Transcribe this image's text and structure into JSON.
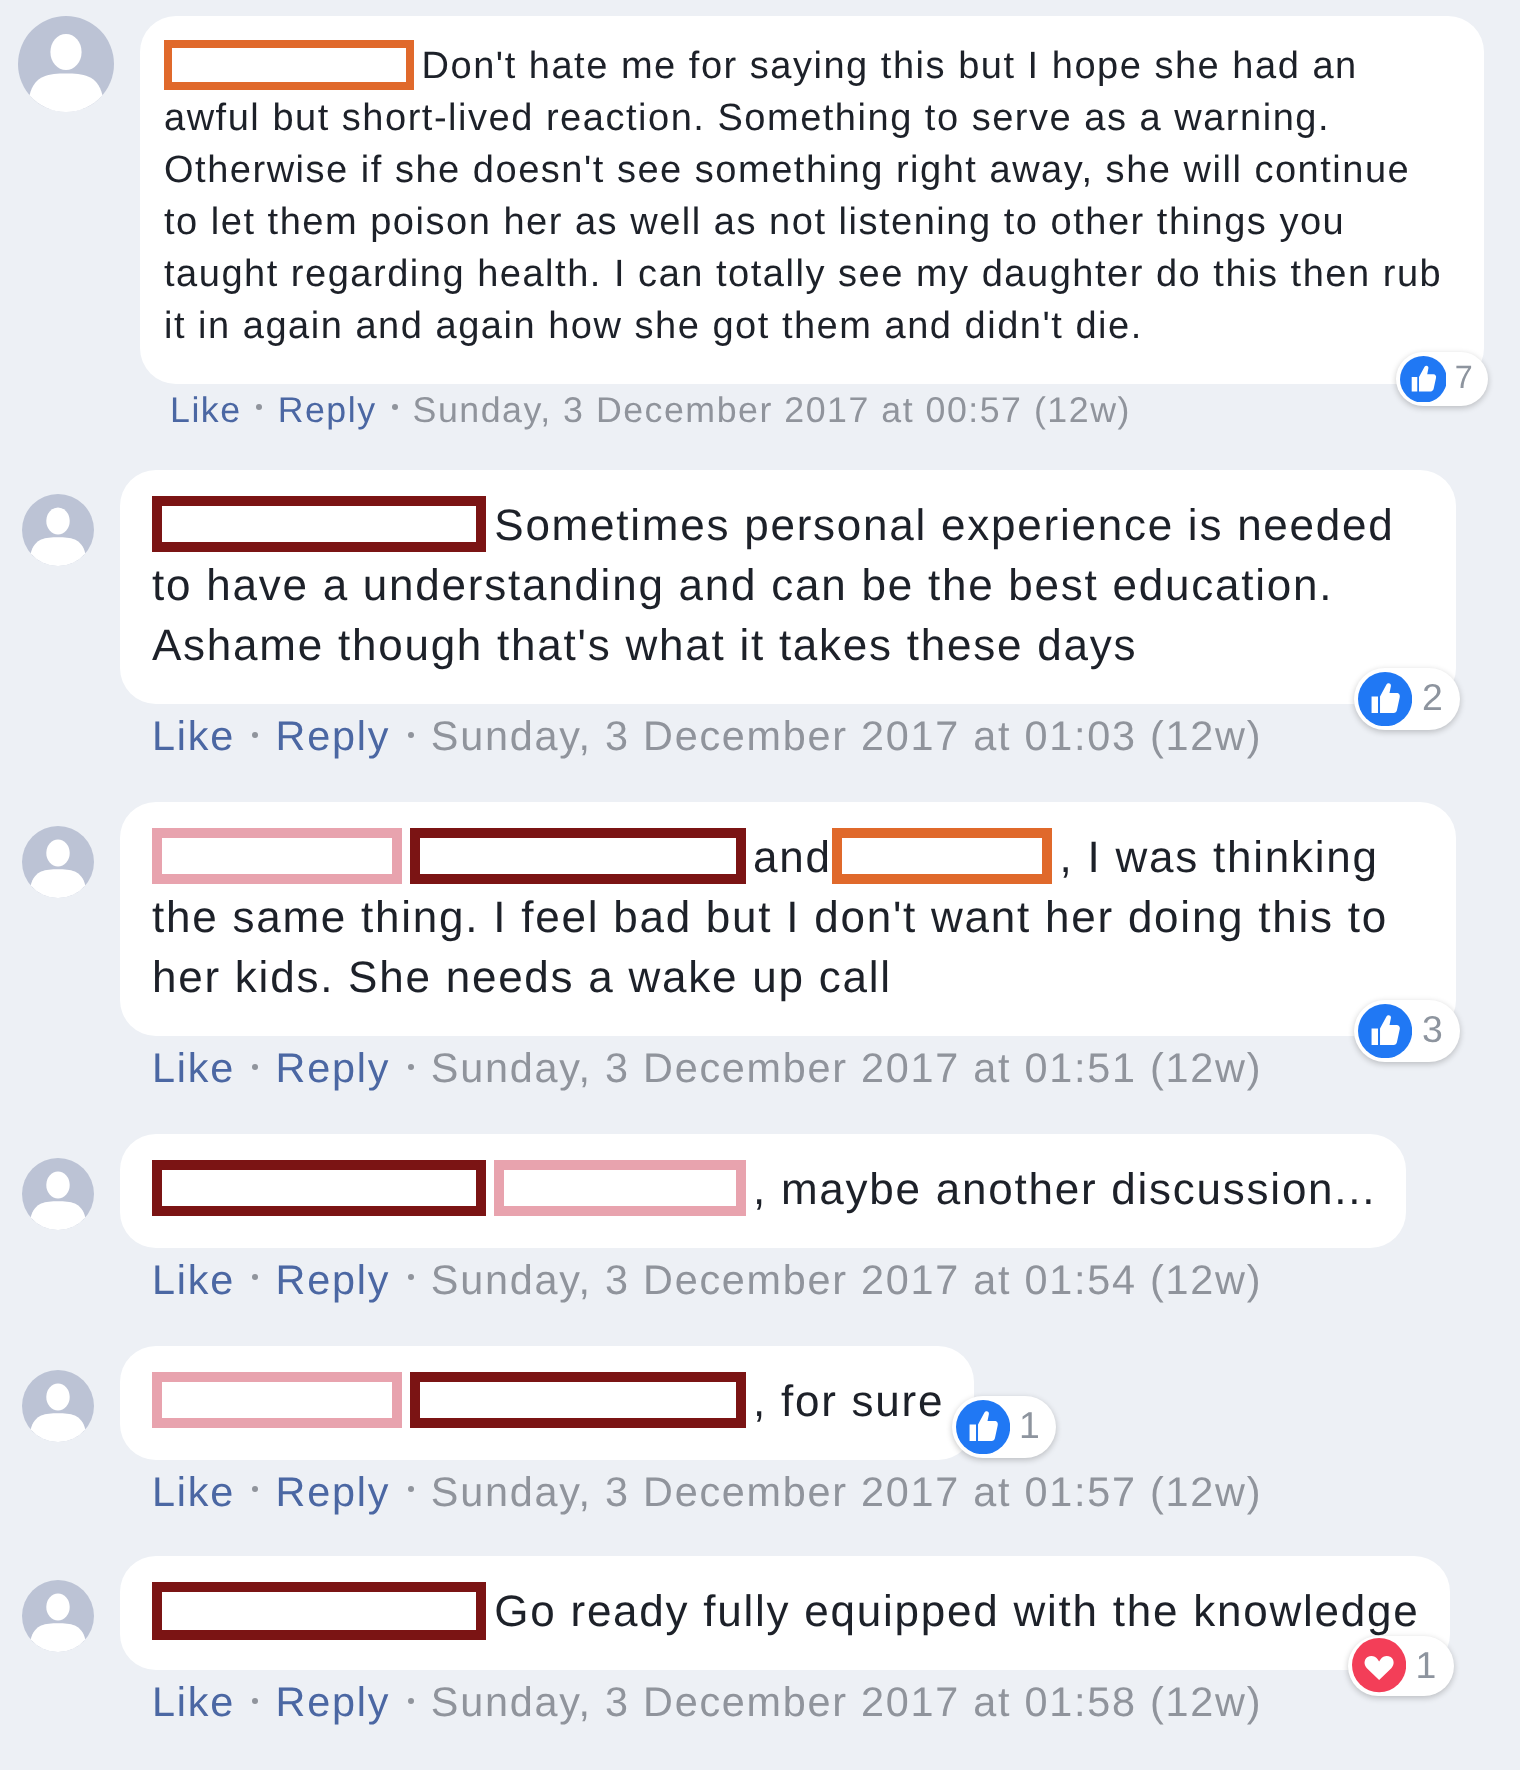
{
  "comments": [
    {
      "body": [
        {
          "kind": "redaction",
          "color": "#e0692b"
        },
        {
          "kind": "text",
          "text": "Don't hate me for saying this but I hope she had an awful but short-lived reaction. Something to serve as a warning. Otherwise if she doesn't see something right away, she will continue to let them poison her as well as not listening to other things you taught regarding health. I can totally see my daughter do this then rub it in again and again how she got them and didn't die."
        }
      ],
      "reaction": {
        "kind": "like",
        "count": "7"
      },
      "like": "Like",
      "reply": "Reply",
      "timestamp": "Sunday, 3 December 2017 at 00:57 (12w)"
    },
    {
      "body": [
        {
          "kind": "redaction",
          "color": "#7b1414"
        },
        {
          "kind": "text",
          "text": "Sometimes personal experience is needed to have a understanding and can be the best education. Ashame though that's what it takes these days"
        }
      ],
      "reaction": {
        "kind": "like",
        "count": "2"
      },
      "like": "Like",
      "reply": "Reply",
      "timestamp": "Sunday, 3 December 2017 at 01:03 (12w)"
    },
    {
      "body": [
        {
          "kind": "redaction",
          "color": "#e8a3ae"
        },
        {
          "kind": "redaction",
          "color": "#7b1414"
        },
        {
          "kind": "text",
          "text": "and"
        },
        {
          "kind": "redaction",
          "color": "#e0692b"
        },
        {
          "kind": "text",
          "text": ", I was thinking the same thing. I feel bad but I don't want her doing this to her kids. She needs a wake up call"
        }
      ],
      "reaction": {
        "kind": "like",
        "count": "3"
      },
      "like": "Like",
      "reply": "Reply",
      "timestamp": "Sunday, 3 December 2017 at 01:51 (12w)"
    },
    {
      "body": [
        {
          "kind": "redaction",
          "color": "#7b1414"
        },
        {
          "kind": "redaction",
          "color": "#e8a3ae"
        },
        {
          "kind": "text",
          "text": ", maybe another discussion..."
        }
      ],
      "like": "Like",
      "reply": "Reply",
      "timestamp": "Sunday, 3 December 2017 at 01:54 (12w)"
    },
    {
      "body": [
        {
          "kind": "redaction",
          "color": "#e8a3ae"
        },
        {
          "kind": "redaction",
          "color": "#7b1414"
        },
        {
          "kind": "text",
          "text": ", for sure"
        }
      ],
      "reaction": {
        "kind": "like",
        "count": "1"
      },
      "like": "Like",
      "reply": "Reply",
      "timestamp": "Sunday, 3 December 2017 at 01:57 (12w)"
    },
    {
      "body": [
        {
          "kind": "redaction",
          "color": "#7b1414"
        },
        {
          "kind": "text",
          "text": "Go ready fully equipped with the knowledge"
        }
      ],
      "reaction": {
        "kind": "love",
        "count": "1"
      },
      "like": "Like",
      "reply": "Reply",
      "timestamp": "Sunday, 3 December 2017 at 01:58 (12w)"
    }
  ]
}
